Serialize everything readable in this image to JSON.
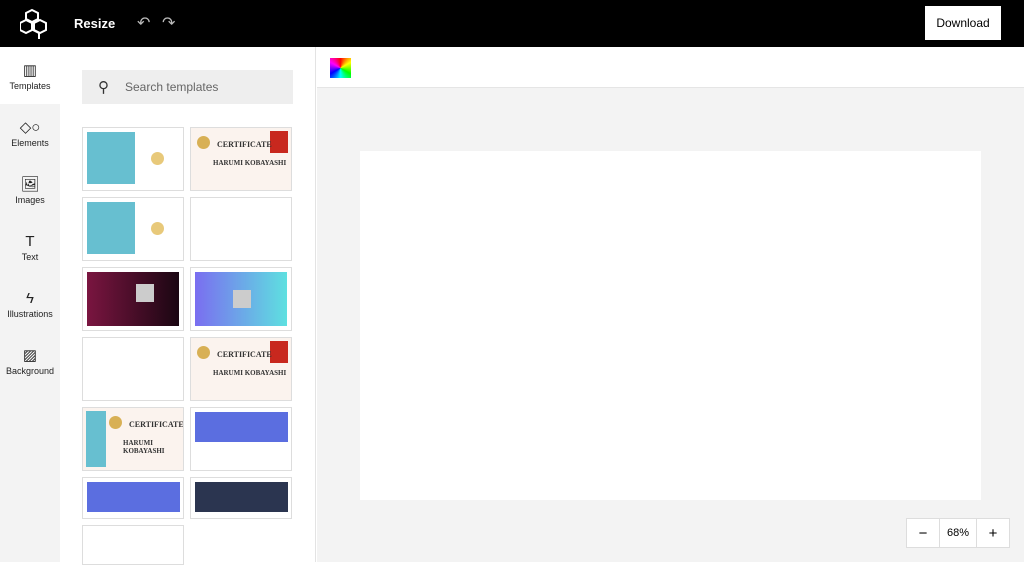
{
  "header": {
    "title": "Resize",
    "download_label": "Download"
  },
  "rail": [
    {
      "label": "Templates",
      "icon": "▥"
    },
    {
      "label": "Elements",
      "icon": "◇○"
    },
    {
      "label": "Images",
      "icon": "🖼"
    },
    {
      "label": "Text",
      "icon": "T"
    },
    {
      "label": "Illustrations",
      "icon": "ϟ"
    },
    {
      "label": "Background",
      "icon": "▨"
    }
  ],
  "search": {
    "placeholder": "Search templates"
  },
  "cert": {
    "title": "CERTIFICATE",
    "name": "HARUMI KOBAYASHI"
  },
  "zoom": {
    "minus": "−",
    "value": "68%",
    "plus": "+"
  }
}
